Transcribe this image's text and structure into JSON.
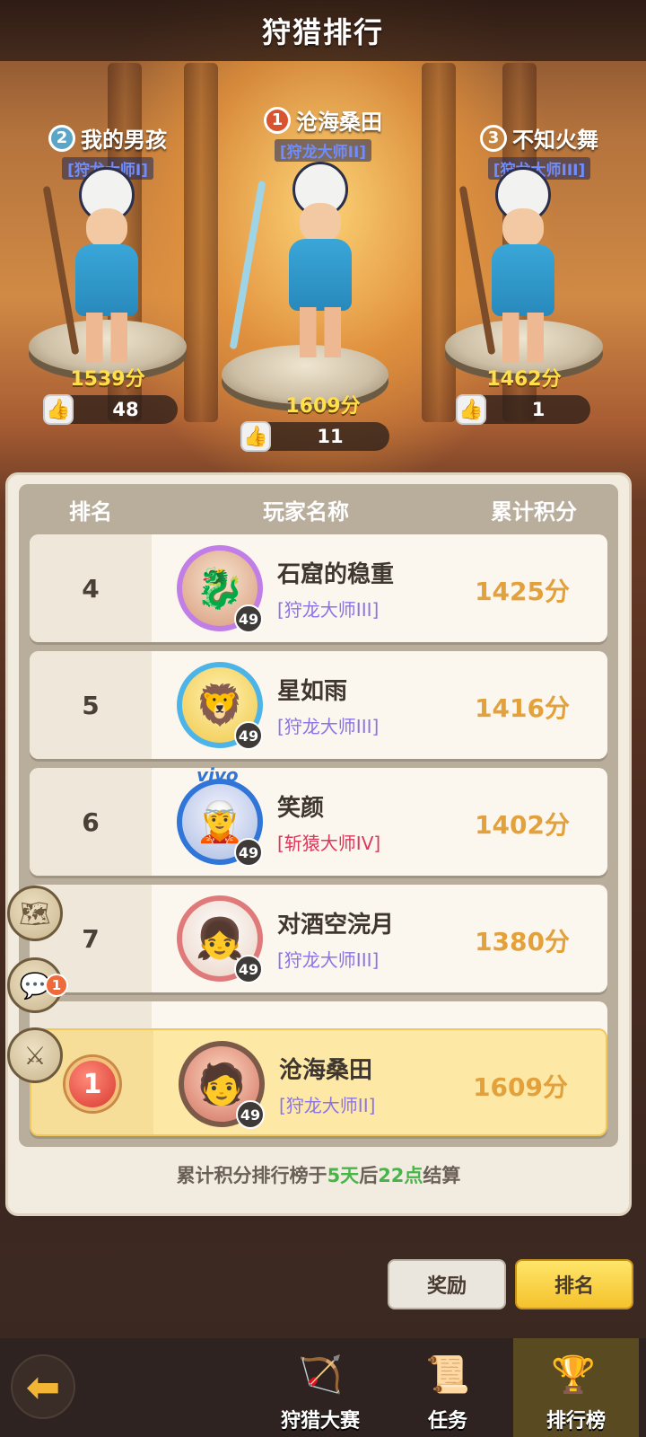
{
  "header": {
    "title": "狩猎排行"
  },
  "podium": [
    {
      "rank": "2",
      "name": "我的男孩",
      "title": "[狩龙大师I]",
      "score": "1539分",
      "likes": "48",
      "medal_color": "#5aa6c9"
    },
    {
      "rank": "1",
      "name": "沧海桑田",
      "title": "[狩龙大师II]",
      "score": "1609分",
      "likes": "11",
      "medal_color": "#d8542e"
    },
    {
      "rank": "3",
      "name": "不知火舞",
      "title": "[狩龙大师III]",
      "score": "1462分",
      "likes": "1",
      "medal_color": "#c6843e"
    }
  ],
  "table": {
    "headers": [
      "排名",
      "玩家名称",
      "累计积分"
    ],
    "rows": [
      {
        "rank": "4",
        "name": "石窟的稳重",
        "title": "[狩龙大师III]",
        "score": "1425分",
        "level": "49",
        "avatar": "dragon-avatar-icon",
        "ring": "#c07ee6"
      },
      {
        "rank": "5",
        "name": "星如雨",
        "title": "[狩龙大师III]",
        "score": "1416分",
        "level": "49",
        "avatar": "lion-avatar-icon",
        "ring": "#4db4e8"
      },
      {
        "rank": "6",
        "name": "笑颜",
        "title": "[斩猿大师IV]",
        "score": "1402分",
        "level": "49",
        "avatar": "silver-hair-avatar-icon",
        "ring": "#2f76d8",
        "badge": "vivo"
      },
      {
        "rank": "7",
        "name": "对酒空浣月",
        "title": "[狩龙大师III]",
        "score": "1380分",
        "level": "49",
        "avatar": "girl-avatar-icon",
        "ring": "#e07a7a"
      }
    ],
    "mine": {
      "rank": "1",
      "name": "沧海桑田",
      "title": "[狩龙大师II]",
      "score": "1609分",
      "level": "49",
      "avatar": "red-hair-avatar-icon"
    }
  },
  "settle_note": {
    "prefix": "累计积分排行榜于",
    "days": "5天",
    "mid": "后",
    "hour": "22点",
    "suffix": "结算"
  },
  "side_buttons": [
    {
      "icon": "map-scroll-icon"
    },
    {
      "icon": "chat-bubble-icon",
      "notification": "1"
    },
    {
      "icon": "sword-icon"
    }
  ],
  "tabs": {
    "reward": "奖励",
    "rank": "排名"
  },
  "bottom_nav": [
    {
      "label": "狩猎大赛",
      "icon": "bow-arrow-icon"
    },
    {
      "label": "任务",
      "icon": "scroll-star-icon"
    },
    {
      "label": "排行榜",
      "icon": "podium-icon",
      "active": true
    }
  ],
  "back_icon": "back-arrow-icon"
}
